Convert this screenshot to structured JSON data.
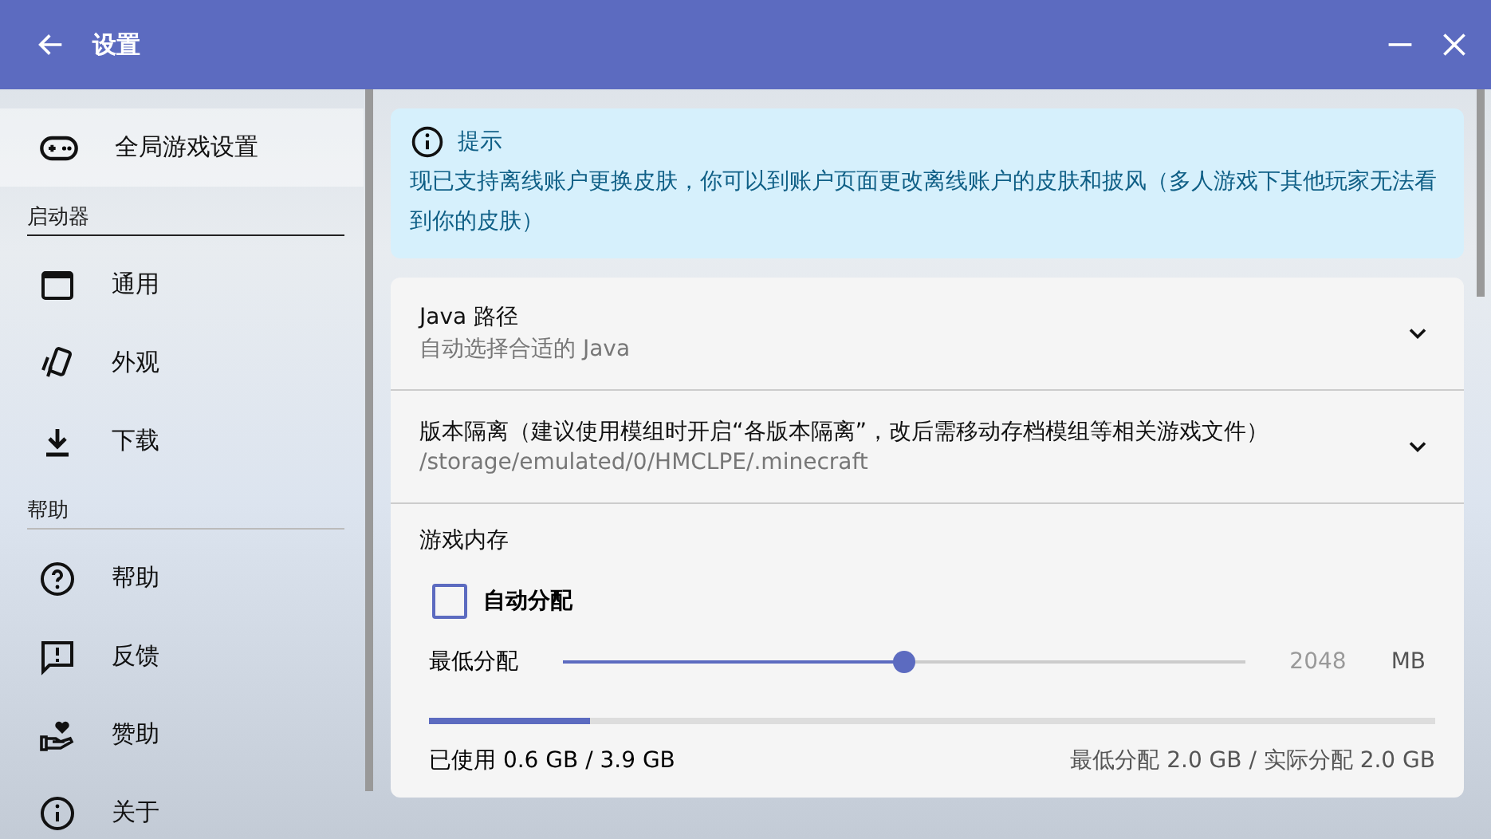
{
  "window": {
    "title": "设置"
  },
  "sidebar": {
    "top_item": {
      "label": "全局游戏设置",
      "kind": "gamepad",
      "selected": true
    },
    "sections": [
      {
        "heading": "启动器",
        "items": [
          {
            "label": "通用",
            "kind": "window",
            "selected": false
          },
          {
            "label": "外观",
            "kind": "cards",
            "selected": false
          },
          {
            "label": "下载",
            "kind": "download",
            "selected": false
          }
        ]
      },
      {
        "heading": "帮助",
        "items": [
          {
            "label": "帮助",
            "kind": "help",
            "selected": false
          },
          {
            "label": "反馈",
            "kind": "feedback",
            "selected": false
          },
          {
            "label": "赞助",
            "kind": "donate",
            "selected": false
          },
          {
            "label": "关于",
            "kind": "info",
            "selected": false
          }
        ]
      }
    ]
  },
  "notice": {
    "title": "提示",
    "text": "现已支持离线账户更换皮肤，你可以到账户页面更改离线账户的皮肤和披风（多人游戏下其他玩家无法看到你的皮肤）"
  },
  "settings": [
    {
      "title": "Java 路径",
      "subtitle": "自动选择合适的 Java",
      "expanded": false
    },
    {
      "title": "版本隔离（建议使用模组时开启“各版本隔离”，改后需移动存档模组等相关游戏文件）",
      "subtitle": "/storage/emulated/0/HMCLPE/.minecraft",
      "expanded": false
    }
  ],
  "memory": {
    "title": "游戏内存",
    "auto": {
      "label": "自动分配",
      "checked": false
    },
    "min": {
      "label": "最低分配",
      "level": 0.5,
      "value": "2048",
      "unit": "MB"
    },
    "usage": {
      "level": 0.16,
      "used": "已使用 0.6 GB / 3.9 GB",
      "allocation": "最低分配 2.0 GB / 实际分配 2.0 GB"
    }
  }
}
